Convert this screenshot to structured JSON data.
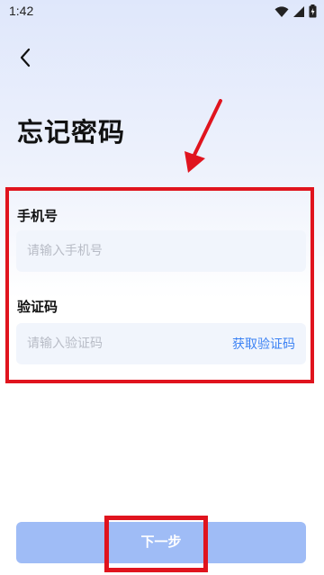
{
  "status_bar": {
    "time": "1:42"
  },
  "header": {
    "back_icon": "chevron-left-icon",
    "title": "忘记密码"
  },
  "form": {
    "phone": {
      "label": "手机号",
      "placeholder": "请输入手机号"
    },
    "code": {
      "label": "验证码",
      "placeholder": "请输入验证码",
      "get_code_label": "获取验证码"
    }
  },
  "actions": {
    "next_label": "下一步"
  },
  "colors": {
    "accent": "#3c82f4",
    "button": "#9fbcf6",
    "annotation": "#e0141e",
    "field_bg": "#f1f5fc"
  }
}
